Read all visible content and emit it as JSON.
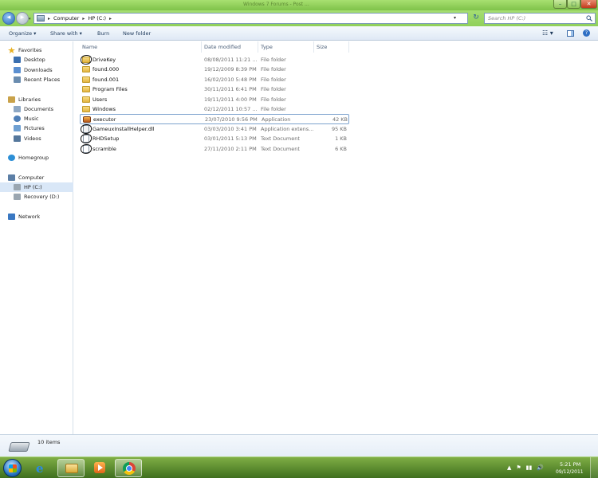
{
  "window": {
    "title": "Windows 7 Forums - Post ...",
    "controls": {
      "minimize": "–",
      "maximize": "□",
      "close": "✕"
    }
  },
  "address_bar": {
    "crumbs": [
      "Computer",
      "HP (C:)"
    ],
    "separator": "▸",
    "dropdown": "▾",
    "refresh": "↻"
  },
  "search": {
    "placeholder": "Search HP (C:)",
    "icon": "search-icon"
  },
  "toolbar": {
    "organize": "Organize ▾",
    "share_with": "Share with ▾",
    "burn": "Burn",
    "new_folder": "New folder",
    "views": "☷ ▾",
    "help": "?"
  },
  "sidebar": {
    "items": [
      {
        "label": "Favorites",
        "icon": "star-icon",
        "color": "#e8b020"
      },
      {
        "label": "Desktop",
        "icon": "desktop-icon",
        "color": "#3a6fb0"
      },
      {
        "label": "Downloads",
        "icon": "downloads-icon",
        "color": "#5b8fd0"
      },
      {
        "label": "Recent Places",
        "icon": "recent-places-icon",
        "color": "#6a8caf"
      },
      {
        "label": "Libraries",
        "icon": "libraries-icon",
        "color": "#c9a24a"
      },
      {
        "label": "Documents",
        "icon": "documents-icon",
        "color": "#8da7c4"
      },
      {
        "label": "Music",
        "icon": "music-icon",
        "color": "#4f7fb7"
      },
      {
        "label": "Pictures",
        "icon": "pictures-icon",
        "color": "#6fa0d2"
      },
      {
        "label": "Videos",
        "icon": "videos-icon",
        "color": "#55779c"
      },
      {
        "label": "Homegroup",
        "icon": "homegroup-icon",
        "color": "#2d8fd6"
      },
      {
        "label": "Computer",
        "icon": "computer-icon",
        "color": "#5c7fa6"
      },
      {
        "label": "HP (C:)",
        "icon": "drive-icon",
        "color": "#9aa6b1"
      },
      {
        "label": "Recovery (D:)",
        "icon": "drive-icon",
        "color": "#9aa6b1"
      },
      {
        "label": "Network",
        "icon": "network-icon",
        "color": "#3a78c2"
      }
    ]
  },
  "columns": {
    "name": "Name",
    "date": "Date modified",
    "type": "Type",
    "size": "Size"
  },
  "files": [
    {
      "name": "DriveKey",
      "date": "08/08/2011 11:21 ...",
      "type": "File folder",
      "size": ""
    },
    {
      "name": "found.000",
      "date": "19/12/2009 8:39 PM",
      "type": "File folder",
      "size": ""
    },
    {
      "name": "found.001",
      "date": "16/02/2010 5:48 PM",
      "type": "File folder",
      "size": ""
    },
    {
      "name": "Program Files",
      "date": "30/11/2011 6:41 PM",
      "type": "File folder",
      "size": ""
    },
    {
      "name": "Users",
      "date": "19/11/2011 4:00 PM",
      "type": "File folder",
      "size": ""
    },
    {
      "name": "Windows",
      "date": "02/12/2011 10:57 ...",
      "type": "File folder",
      "size": ""
    },
    {
      "name": "executor",
      "date": "23/07/2010 9:56 PM",
      "type": "Application",
      "size": "42 KB"
    },
    {
      "name": "GameuxInstallHelper.dll",
      "date": "03/03/2010 3:41 PM",
      "type": "Application extens...",
      "size": "95 KB"
    },
    {
      "name": "RHDSetup",
      "date": "03/01/2011 5:13 PM",
      "type": "Text Document",
      "size": "1 KB"
    },
    {
      "name": "scramble",
      "date": "27/11/2010 2:11 PM",
      "type": "Text Document",
      "size": "6 KB"
    }
  ],
  "status": {
    "item_count": "10 items"
  },
  "taskbar": {
    "tray_icons": [
      "▲",
      "⚑",
      "▮▮",
      "🔊"
    ],
    "clock_time": "5:21 PM",
    "clock_date": "09/12/2011"
  }
}
